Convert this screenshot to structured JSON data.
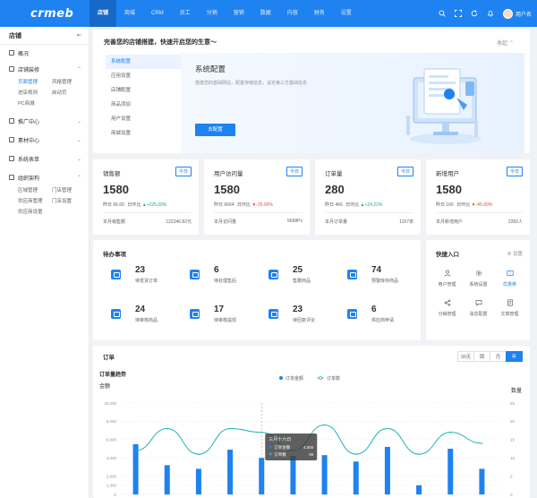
{
  "brand": {
    "logo": "crmeb",
    "accent": "#1e82f0"
  },
  "topnav": [
    "店铺",
    "商城",
    "CRM",
    "员工",
    "分销",
    "营销",
    "数据",
    "内容",
    "财务",
    "设置"
  ],
  "topbar_right": {
    "icons": [
      "search-icon",
      "fullscreen-icon",
      "refresh-icon",
      "bell-icon"
    ],
    "username": "用户名"
  },
  "sidebar": {
    "title": "店铺",
    "overview": "概况",
    "groups": [
      {
        "label": "店铺装修",
        "subitems": [
          "页面管理",
          "风格管理",
          "进店规则",
          "启动页",
          "PC商城"
        ]
      },
      {
        "label": "推广中心",
        "subitems": []
      },
      {
        "label": "素材中心",
        "subitems": []
      },
      {
        "label": "系统表单",
        "subitems": []
      },
      {
        "label": "组织架构",
        "subitems": [
          "区域管理",
          "门店管理",
          "供应商管理",
          "门店设置",
          "供应商设置"
        ]
      }
    ]
  },
  "welcome": {
    "title": "完善您的店铺搭建，快速开启您的生意～",
    "collapse": "收起",
    "steps": [
      "系统配置",
      "应用设置",
      "店铺配置",
      "商品添加",
      "用户设置",
      "商城设置"
    ],
    "panel_title": "系统配置",
    "panel_desc": "搭建您的基础网站，配置存储信息，设定第三方基础信息",
    "button": "去配置"
  },
  "stats": [
    {
      "title": "销售额",
      "badge": "今日",
      "value": "1580",
      "compare_label": "昨日",
      "compare_value": "66.00",
      "ratio_label": "日环比",
      "ratio": "+225.00%",
      "trend": "up",
      "footer_label": "本月销售额",
      "footer_value": "122246.82元"
    },
    {
      "title": "用户访问量",
      "badge": "今日",
      "value": "1580",
      "compare_label": "昨日",
      "compare_value": "6664",
      "ratio_label": "日环比",
      "ratio": "-25.00%",
      "trend": "down",
      "footer_label": "本月访问量",
      "footer_value": "5668Pv"
    },
    {
      "title": "订单量",
      "badge": "今日",
      "value": "280",
      "compare_label": "昨日",
      "compare_value": "466",
      "ratio_label": "日环比",
      "ratio": "+24.22%",
      "trend": "up",
      "footer_label": "本月订单量",
      "footer_value": "1157单"
    },
    {
      "title": "新增用户",
      "badge": "今日",
      "value": "1580",
      "compare_label": "昨日",
      "compare_value": "166",
      "ratio_label": "日环比",
      "ratio": "-45.00%",
      "trend": "down",
      "footer_label": "本月新增用户",
      "footer_value": "2282人"
    }
  ],
  "todo": {
    "title": "待办事项",
    "items": [
      {
        "count": "23",
        "label": "待发货订单"
      },
      {
        "count": "6",
        "label": "待处理售后"
      },
      {
        "count": "25",
        "label": "售罄商品"
      },
      {
        "count": "74",
        "label": "预警库存商品"
      },
      {
        "count": "24",
        "label": "待审核商品"
      },
      {
        "count": "17",
        "label": "待审核提现"
      },
      {
        "count": "23",
        "label": "待回复评论"
      },
      {
        "count": "6",
        "label": "供应商申请"
      }
    ]
  },
  "quick": {
    "title": "快捷入口",
    "settings": "设置",
    "items": [
      {
        "label": "用户管理",
        "icon": "user-icon"
      },
      {
        "label": "系统设置",
        "icon": "gear-icon"
      },
      {
        "label": "优惠券",
        "icon": "coupon-icon"
      },
      {
        "label": "分销管理",
        "icon": "share-icon"
      },
      {
        "label": "消息配置",
        "icon": "message-icon"
      },
      {
        "label": "文章管理",
        "icon": "article-icon"
      }
    ]
  },
  "orders": {
    "title": "订单",
    "subtitle": "订单量趋势",
    "ranges": [
      "30天",
      "周",
      "月",
      "年"
    ],
    "active_range": "年"
  },
  "chart_data": {
    "type": "bar",
    "title": "订单量趋势",
    "ylabel": "金额",
    "y2label": "数量",
    "categories": [
      "一月",
      "二月",
      "三月",
      "四月",
      "五月",
      "六月",
      "七月",
      "八月",
      "九月",
      "十月",
      "十一月",
      "十二月"
    ],
    "ylim": [
      0,
      10000
    ],
    "yticks": [
      0,
      1000,
      2000,
      4000,
      6000,
      8000,
      10000
    ],
    "yticklabels": [
      "0",
      "1,000",
      "2,000",
      "4,000",
      "6,000",
      "8,000",
      "10,000"
    ],
    "y2lim": [
      0,
      25
    ],
    "y2ticks": [
      0,
      5,
      10,
      15,
      20,
      25
    ],
    "legend": "top-center",
    "series": [
      {
        "name": "订单金额",
        "type": "bar",
        "color": "#1e82f0",
        "values": [
          5500,
          3200,
          2800,
          4900,
          4000,
          4200,
          4300,
          3600,
          5200,
          1000,
          5000,
          2800
        ]
      },
      {
        "name": "订单数",
        "type": "line",
        "axis": "right",
        "color": "#1fb3b3",
        "values": [
          12,
          18,
          11,
          18,
          17,
          12,
          19,
          11,
          18,
          11,
          17,
          14
        ]
      }
    ],
    "tooltip": {
      "title": "三月十六日",
      "rows": [
        {
          "label": "订单金额",
          "value": "4,000"
        },
        {
          "label": "订单数",
          "value": "90"
        }
      ]
    }
  }
}
